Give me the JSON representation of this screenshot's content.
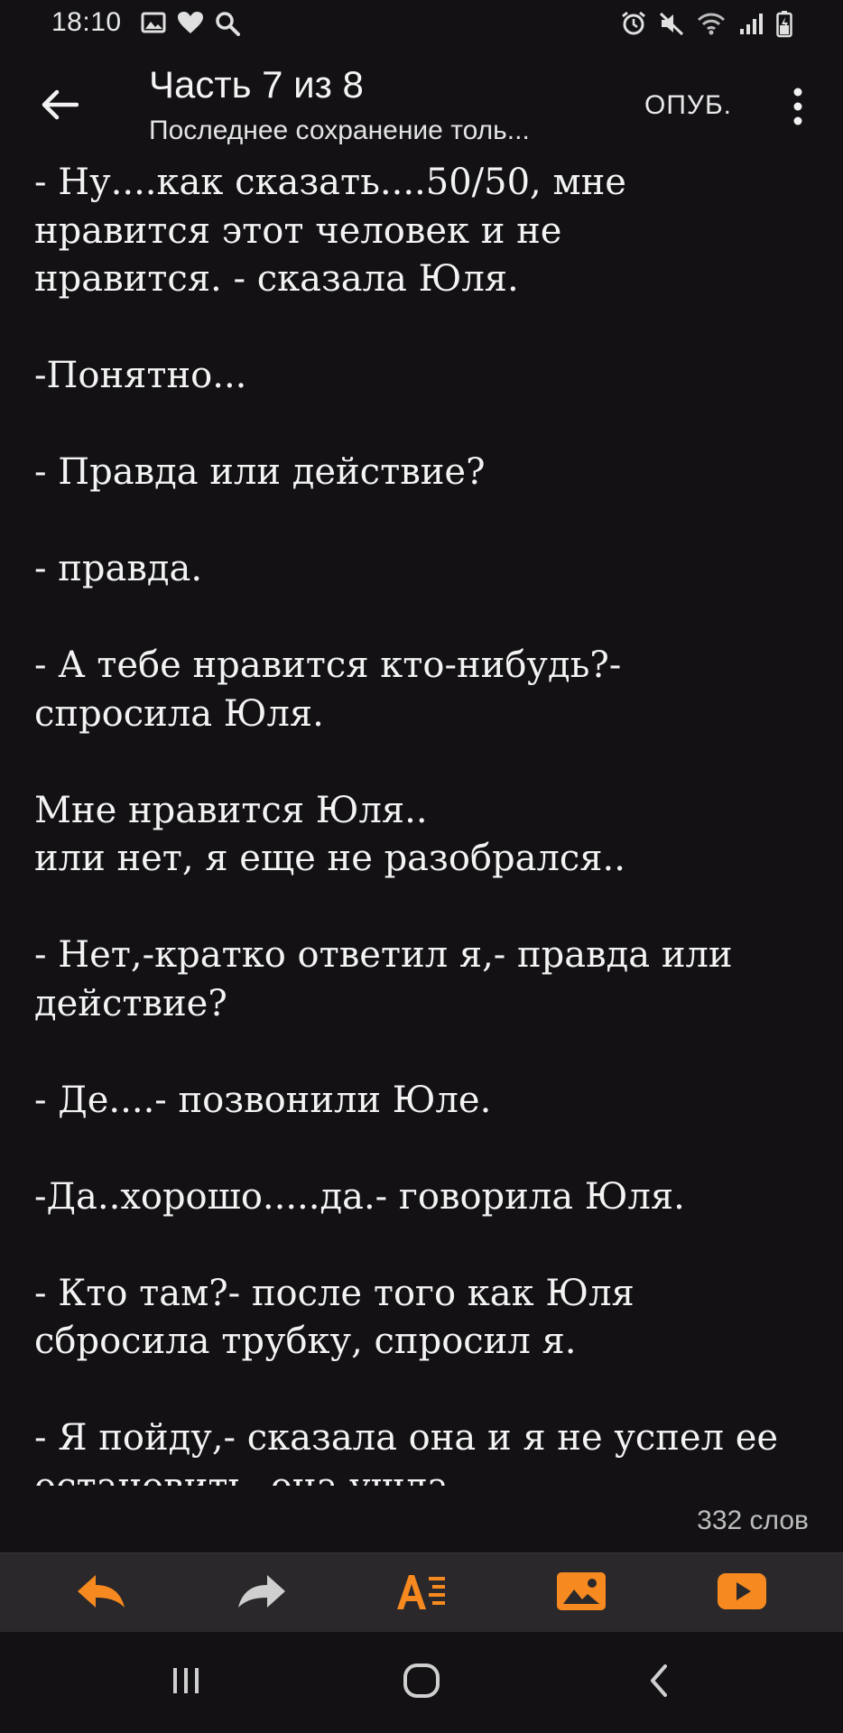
{
  "status_bar": {
    "time": "18:10",
    "icons": [
      "image-icon",
      "heart-icon",
      "search-icon",
      "alarm-icon",
      "mute-icon",
      "wifi-icon",
      "signal-icon",
      "battery-icon"
    ]
  },
  "header": {
    "title": "Часть 7 из 8",
    "subtitle": "Последнее сохранение толь...",
    "publish_label": "ОПУБ."
  },
  "content": {
    "paragraphs": [
      [
        "- Ну....как сказать....50/50, мне",
        "нравится этот человек и не",
        "нравится. - сказала Юля."
      ],
      [
        "-Понятно..."
      ],
      [
        "- Правда или действие?"
      ],
      [
        "- правда."
      ],
      [
        "- А тебе нравится кто-нибудь?-",
        "спросила Юля."
      ],
      [
        "Мне нравится Юля..",
        "или нет, я еще не разобрался.."
      ],
      [
        "- Нет,-кратко ответил я,- правда или",
        "действие?"
      ],
      [
        "- Де....- позвонили Юле."
      ],
      [
        "-Да..хорошо.....да.- говорила Юля."
      ],
      [
        "- Кто там?- после того как Юля",
        "сбросила трубку, спросил я."
      ],
      [
        "- Я пойду,- сказала она и я не успел ее",
        "остановить. она ушла."
      ]
    ]
  },
  "word_count": "332 слов",
  "toolbar": {
    "tools": [
      "undo-icon",
      "redo-icon",
      "text-format-icon",
      "insert-image-icon",
      "insert-video-icon"
    ],
    "accent_color": "#f6891f"
  },
  "navbar": {
    "buttons": [
      "recent-apps-icon",
      "home-icon",
      "back-nav-icon"
    ]
  }
}
